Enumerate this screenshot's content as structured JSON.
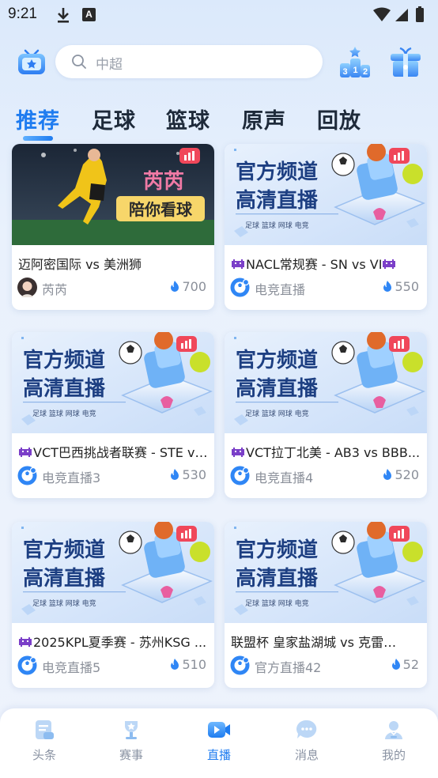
{
  "status_bar": {
    "time": "9:21",
    "a_badge": "A"
  },
  "search": {
    "placeholder": "中超"
  },
  "header": {
    "left_icon": "tv-icon",
    "rank_icon": "rank-podium-icon",
    "rank_digits": [
      "3",
      "1",
      "2"
    ],
    "gift_icon": "gift-icon"
  },
  "tabs": [
    {
      "label": "推荐",
      "active": true
    },
    {
      "label": "足球",
      "active": false
    },
    {
      "label": "篮球",
      "active": false
    },
    {
      "label": "原声",
      "active": false
    },
    {
      "label": "回放",
      "active": false
    }
  ],
  "thumbnail_text": {
    "promo_line1": "官方频道",
    "promo_line2": "高清直播",
    "promo_tags": [
      "足球",
      "篮球",
      "网球",
      "电竞"
    ],
    "streamer_name_art": "芮芮",
    "streamer_tagline": "陪你看球"
  },
  "streams": [
    {
      "title": "迈阿密国际 vs 美洲狮",
      "title_emoji": false,
      "streamer": "芮芮",
      "heat": "700",
      "thumb": "photo",
      "avatar": "photo"
    },
    {
      "title": "NACL常规赛 -  SN vs VI",
      "title_emoji": true,
      "title_emoji_end": true,
      "streamer": "电竞直播",
      "heat": "550",
      "thumb": "promo",
      "avatar": "logo"
    },
    {
      "title": "VCT巴西挑战者联赛 -  STE vs ...",
      "title_emoji": true,
      "streamer": "电竞直播3",
      "heat": "530",
      "thumb": "promo",
      "avatar": "logo"
    },
    {
      "title": "VCT拉丁北美 -  AB3 vs BBB...",
      "title_emoji": true,
      "streamer": "电竞直播4",
      "heat": "520",
      "thumb": "promo",
      "avatar": "logo"
    },
    {
      "title": "2025KPL夏季赛 -  苏州KSG ...",
      "title_emoji": true,
      "streamer": "电竞直播5",
      "heat": "510",
      "thumb": "promo",
      "avatar": "logo"
    },
    {
      "title": " 联盟杯 皇家盐湖城 vs 克雷…",
      "title_emoji": false,
      "streamer": "官方直播42",
      "heat": "52",
      "thumb": "promo",
      "avatar": "logo"
    }
  ],
  "bottom_nav": [
    {
      "label": "头条",
      "icon": "news-icon",
      "active": false
    },
    {
      "label": "赛事",
      "icon": "trophy-icon",
      "active": false
    },
    {
      "label": "直播",
      "icon": "live-video-icon",
      "active": true
    },
    {
      "label": "消息",
      "icon": "message-icon",
      "active": false
    },
    {
      "label": "我的",
      "icon": "profile-icon",
      "active": false
    }
  ],
  "colors": {
    "accent": "#1f7cf0",
    "heat_flame": "#2f86f5",
    "live_badge": "#f0475a"
  }
}
